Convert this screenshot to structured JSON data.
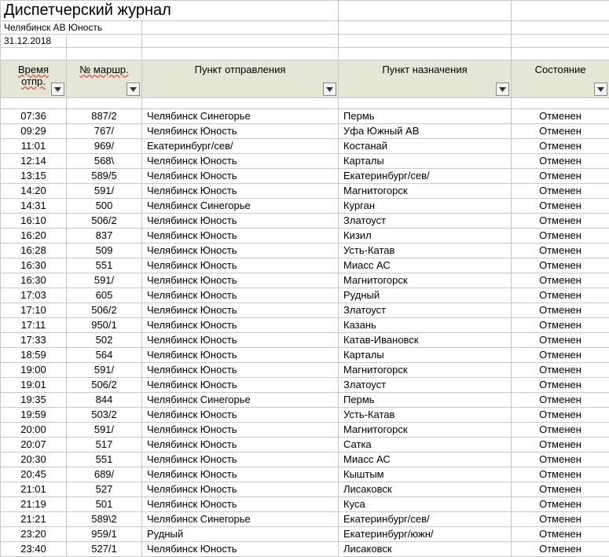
{
  "title": "Диспетчерский журнал",
  "station": "Челябинск АВ Юность",
  "date": "31.12.2018",
  "columns": {
    "time": "Время отпр.",
    "route": "№ маршр.",
    "departure": "Пункт отправления",
    "destination": "Пункт назначения",
    "status": "Состояние"
  },
  "rows": [
    {
      "time": "07:36",
      "route": "887/2",
      "dep": "Челябинск Синегорье",
      "dest": "Пермь",
      "status": "Отменен"
    },
    {
      "time": "09:29",
      "route": "767/",
      "dep": "Челябинск Юность",
      "dest": "Уфа Южный АВ",
      "status": "Отменен"
    },
    {
      "time": "11:01",
      "route": "969/",
      "dep": "Екатеринбург/сев/",
      "dest": "Костанай",
      "status": "Отменен"
    },
    {
      "time": "12:14",
      "route": "568\\",
      "dep": "Челябинск Юность",
      "dest": "Карталы",
      "status": "Отменен"
    },
    {
      "time": "13:15",
      "route": "589/5",
      "dep": "Челябинск Юность",
      "dest": "Екатеринбург/сев/",
      "status": "Отменен"
    },
    {
      "time": "14:20",
      "route": "591/",
      "dep": "Челябинск Юность",
      "dest": "Магнитогорск",
      "status": "Отменен"
    },
    {
      "time": "14:31",
      "route": "500",
      "dep": "Челябинск Синегорье",
      "dest": "Курган",
      "status": "Отменен"
    },
    {
      "time": "16:10",
      "route": "506/2",
      "dep": "Челябинск Юность",
      "dest": "Златоуст",
      "status": "Отменен"
    },
    {
      "time": "16:20",
      "route": "837",
      "dep": "Челябинск Юность",
      "dest": "Кизил",
      "status": "Отменен"
    },
    {
      "time": "16:28",
      "route": "509",
      "dep": "Челябинск Юность",
      "dest": "Усть-Катав",
      "status": "Отменен"
    },
    {
      "time": "16:30",
      "route": "551",
      "dep": "Челябинск Юность",
      "dest": "Миасс АС",
      "status": "Отменен"
    },
    {
      "time": "16:30",
      "route": "591/",
      "dep": "Челябинск Юность",
      "dest": "Магнитогорск",
      "status": "Отменен"
    },
    {
      "time": "17:03",
      "route": "605",
      "dep": "Челябинск Юность",
      "dest": "Рудный",
      "status": "Отменен"
    },
    {
      "time": "17:10",
      "route": "506/2",
      "dep": "Челябинск Юность",
      "dest": "Златоуст",
      "status": "Отменен"
    },
    {
      "time": "17:11",
      "route": "950/1",
      "dep": "Челябинск Юность",
      "dest": "Казань",
      "status": "Отменен"
    },
    {
      "time": "17:33",
      "route": "502",
      "dep": "Челябинск Юность",
      "dest": "Катав-Ивановск",
      "status": "Отменен"
    },
    {
      "time": "18:59",
      "route": "564",
      "dep": "Челябинск Юность",
      "dest": "Карталы",
      "status": "Отменен"
    },
    {
      "time": "19:00",
      "route": "591/",
      "dep": "Челябинск Юность",
      "dest": "Магнитогорск",
      "status": "Отменен"
    },
    {
      "time": "19:01",
      "route": "506/2",
      "dep": "Челябинск Юность",
      "dest": "Златоуст",
      "status": "Отменен"
    },
    {
      "time": "19:35",
      "route": "844",
      "dep": "Челябинск Синегорье",
      "dest": "Пермь",
      "status": "Отменен"
    },
    {
      "time": "19:59",
      "route": "503/2",
      "dep": "Челябинск Юность",
      "dest": "Усть-Катав",
      "status": "Отменен"
    },
    {
      "time": "20:00",
      "route": "591/",
      "dep": "Челябинск Юность",
      "dest": "Магнитогорск",
      "status": "Отменен"
    },
    {
      "time": "20:07",
      "route": "517",
      "dep": "Челябинск Юность",
      "dest": "Сатка",
      "status": "Отменен"
    },
    {
      "time": "20:30",
      "route": "551",
      "dep": "Челябинск Юность",
      "dest": "Миасс АС",
      "status": "Отменен"
    },
    {
      "time": "20:45",
      "route": "689/",
      "dep": "Челябинск Юность",
      "dest": "Кыштым",
      "status": "Отменен"
    },
    {
      "time": "21:01",
      "route": "527",
      "dep": "Челябинск Юность",
      "dest": "Лисаковск",
      "status": "Отменен"
    },
    {
      "time": "21:19",
      "route": "501",
      "dep": "Челябинск Юность",
      "dest": "Куса",
      "status": "Отменен"
    },
    {
      "time": "21:21",
      "route": "589\\2",
      "dep": "Челябинск Синегорье",
      "dest": "Екатеринбург/сев/",
      "status": "Отменен"
    },
    {
      "time": "23:20",
      "route": "959/1",
      "dep": "Рудный",
      "dest": "Екатеринбург/южн/",
      "status": "Отменен"
    },
    {
      "time": "23:40",
      "route": "527/1",
      "dep": "Челябинск Юность",
      "dest": "Лисаковск",
      "status": "Отменен"
    }
  ]
}
